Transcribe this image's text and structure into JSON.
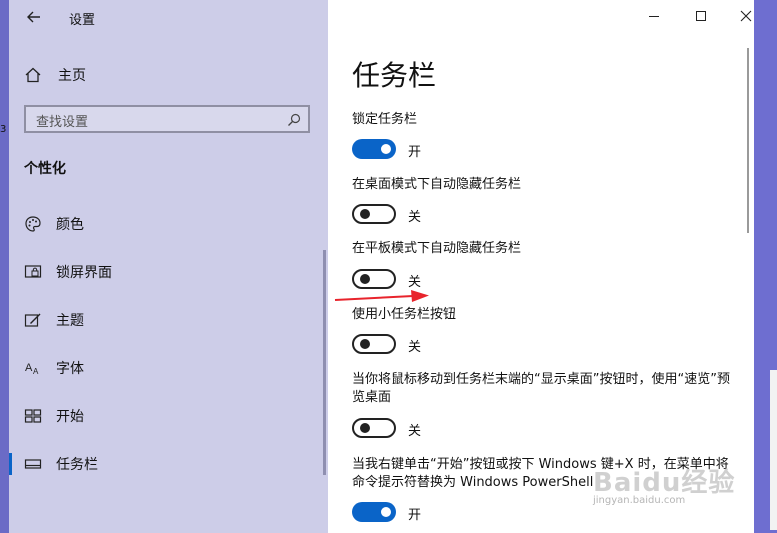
{
  "desktop": {
    "edge_text": "3"
  },
  "window": {
    "title": "设置"
  },
  "sidebar": {
    "home_label": "主页",
    "search_placeholder": "查找设置",
    "section_title": "个性化",
    "items": [
      {
        "label": "颜色",
        "icon": "palette-icon"
      },
      {
        "label": "锁屏界面",
        "icon": "lock-screen-icon"
      },
      {
        "label": "主题",
        "icon": "theme-brush-icon"
      },
      {
        "label": "字体",
        "icon": "font-icon"
      },
      {
        "label": "开始",
        "icon": "start-grid-icon"
      },
      {
        "label": "任务栏",
        "icon": "taskbar-icon",
        "active": true
      }
    ]
  },
  "main": {
    "title": "任务栏",
    "settings": [
      {
        "label": "锁定任务栏",
        "state": "开",
        "on": true
      },
      {
        "label": "在桌面模式下自动隐藏任务栏",
        "state": "关",
        "on": false
      },
      {
        "label": "在平板模式下自动隐藏任务栏",
        "state": "关",
        "on": false
      },
      {
        "label": "使用小任务栏按钮",
        "state": "关",
        "on": false
      },
      {
        "label": "当你将鼠标移动到任务栏末端的“显示桌面”按钮时，使用“速览”预览桌面",
        "state": "关",
        "on": false
      },
      {
        "label": "当我右键单击“开始”按钮或按下 Windows 键+X 时，在菜单中将命令提示符替换为 Windows PowerShell",
        "state": "开",
        "on": true
      }
    ]
  },
  "watermark": {
    "brand": "Baidu经验",
    "url": "jingyan.baidu.com"
  },
  "colors": {
    "accent": "#0a64c8",
    "sidebar_bg": "#cdcde8",
    "annotation_arrow": "#e8242c"
  }
}
